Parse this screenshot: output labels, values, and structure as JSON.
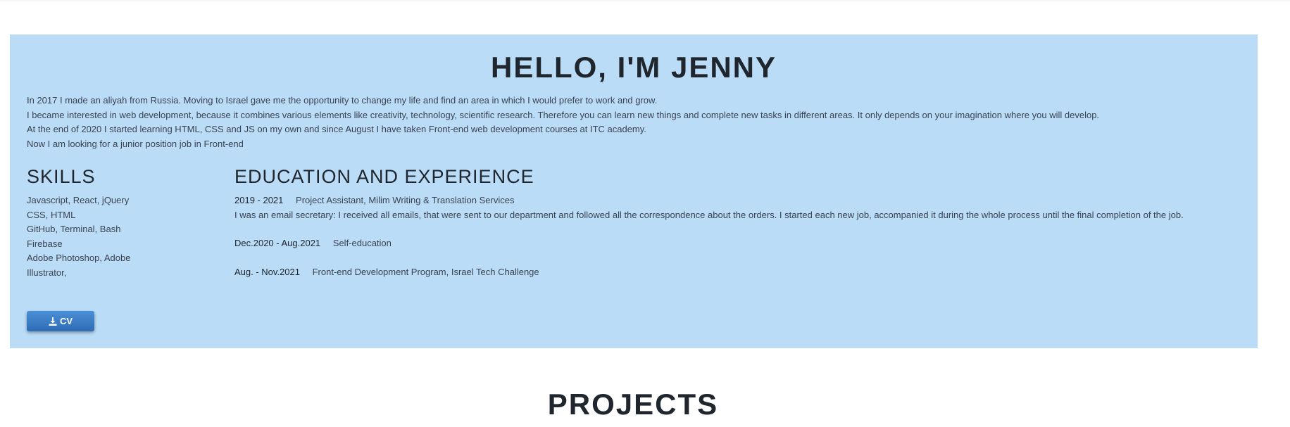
{
  "about": {
    "title": "HELLO, I'M JENNY",
    "bio": [
      "In 2017 I made an aliyah from Russia. Moving to Israel gave me the opportunity to change my life and find an area in which I would prefer to work and grow.",
      "I became interested in web development, because it combines various elements like creativity, technology, scientific research. Therefore you can learn new things and complete new tasks in different areas. It only depends on your imagination where you will develop.",
      "At the end of 2020 I started learning HTML, CSS and JS on my own and since August I have taken Front-end web development courses at ITC academy.",
      "Now I am looking for a junior position job in Front-end"
    ]
  },
  "skills": {
    "heading": "SKILLS",
    "items": [
      "Javascript, React, jQuery",
      "CSS, HTML",
      "GitHub, Terminal, Bash",
      "Firebase",
      "Adobe Photoshop, Adobe Illustrator,"
    ]
  },
  "education": {
    "heading": "EDUCATION AND EXPERIENCE",
    "entries": [
      {
        "dates": "2019 - 2021",
        "title": "Project Assistant, Milim Writing & Translation Services",
        "description": "I was an email secretary: I received all emails, that were sent to our department and followed all the correspondence about the orders. I started each new job, accompanied it during the whole process until the final completion of the job."
      },
      {
        "dates": "Dec.2020 - Aug.2021",
        "title": "Self-education"
      },
      {
        "dates": "Aug. - Nov.2021",
        "title": "Front-end Development Program, Israel Tech Challenge"
      }
    ]
  },
  "cv_button": {
    "label": "CV",
    "icon": "download-icon"
  },
  "projects": {
    "title": "PROJECTS"
  },
  "colors": {
    "about_background": "#badcf7",
    "button": "#3b7cc4",
    "heading_text": "#20262e"
  }
}
